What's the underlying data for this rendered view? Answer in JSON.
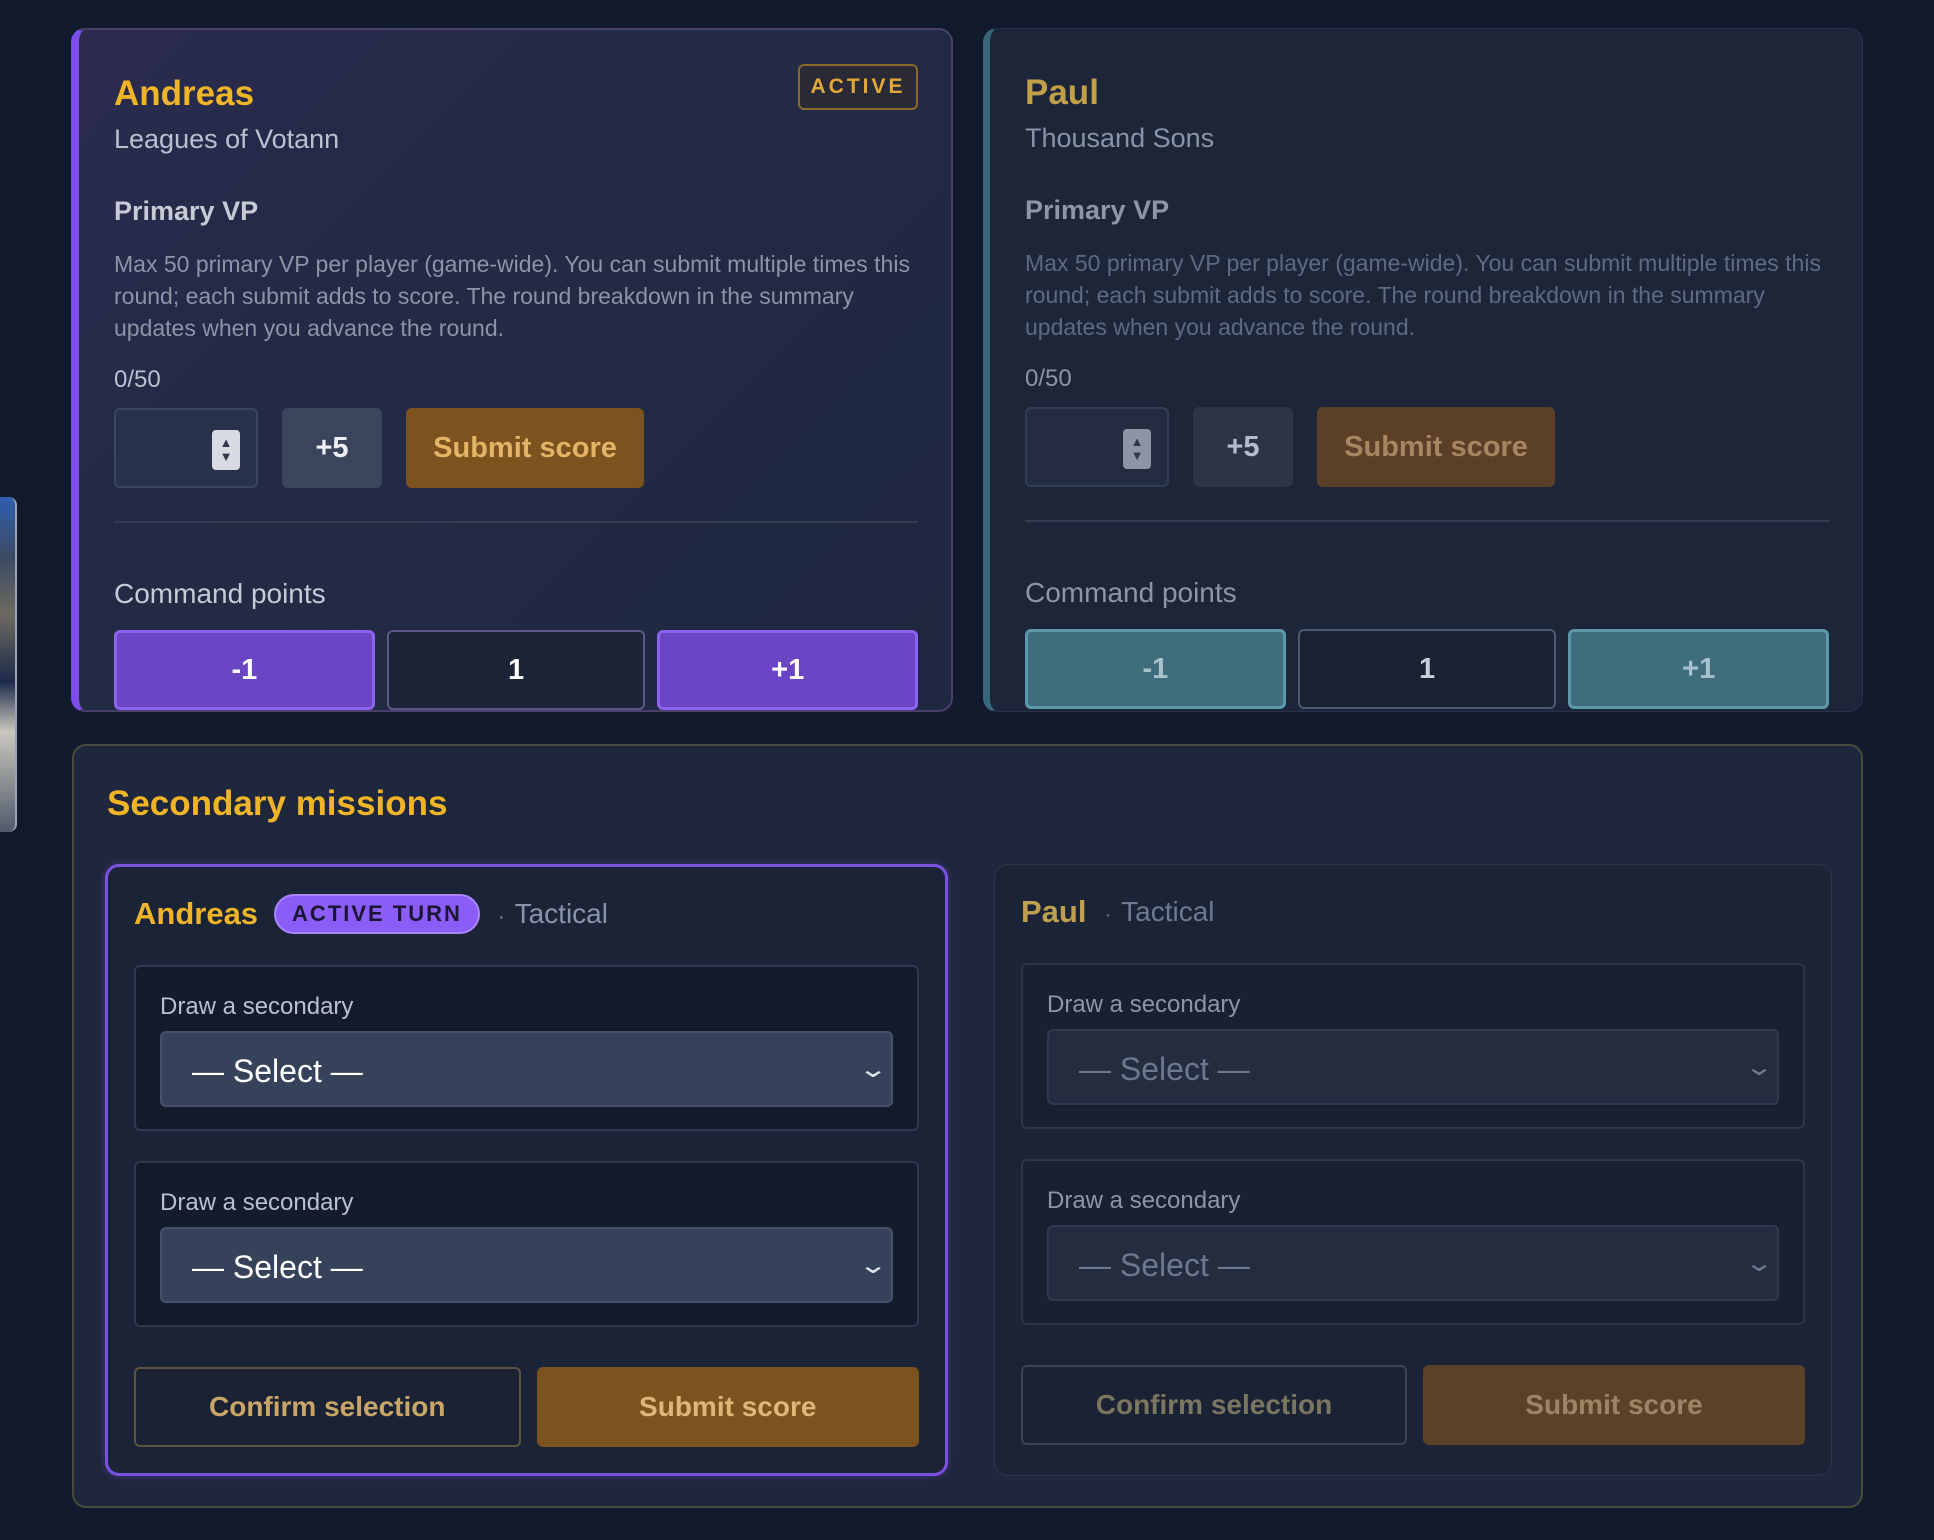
{
  "players": [
    {
      "name": "Andreas",
      "faction": "Leagues of Votann",
      "status_badge": "ACTIVE",
      "primary_label": "Primary VP",
      "primary_help": "Max 50 primary VP per player (game-wide). You can submit multiple times this round; each submit adds to score. The round breakdown in the summary updates when you advance the round.",
      "primary_progress": "0/50",
      "vp_input_value": "",
      "plus5_label": "+5",
      "submit_label": "Submit score",
      "cp_label": "Command points",
      "cp_minus": "-1",
      "cp_value": "1",
      "cp_plus": "+1",
      "accent": "#7c4dea"
    },
    {
      "name": "Paul",
      "faction": "Thousand Sons",
      "primary_label": "Primary VP",
      "primary_help": "Max 50 primary VP per player (game-wide). You can submit multiple times this round; each submit adds to score. The round breakdown in the summary updates when you advance the round.",
      "primary_progress": "0/50",
      "vp_input_value": "",
      "plus5_label": "+5",
      "submit_label": "Submit score",
      "cp_label": "Command points",
      "cp_minus": "-1",
      "cp_value": "1",
      "cp_plus": "+1",
      "accent": "#36687a"
    }
  ],
  "secondary": {
    "title": "Secondary missions",
    "panels": [
      {
        "name": "Andreas",
        "turn_badge": "ACTIVE TURN",
        "type": "Tactical",
        "draws": [
          {
            "label": "Draw a secondary",
            "selected": "— Select —"
          },
          {
            "label": "Draw a secondary",
            "selected": "— Select —"
          }
        ],
        "confirm_label": "Confirm selection",
        "submit_label": "Submit score"
      },
      {
        "name": "Paul",
        "type": "Tactical",
        "draws": [
          {
            "label": "Draw a secondary",
            "selected": "— Select —"
          },
          {
            "label": "Draw a secondary",
            "selected": "— Select —"
          }
        ],
        "confirm_label": "Confirm selection",
        "submit_label": "Submit score"
      }
    ]
  },
  "colors": {
    "background": "#121a2d",
    "highlight": "#f0b429",
    "submit": "#7c521f",
    "active_accent": "#8b5cf6"
  },
  "icons": {
    "spinner": "number-spinner-icon",
    "chevron": "chevron-down-icon"
  }
}
